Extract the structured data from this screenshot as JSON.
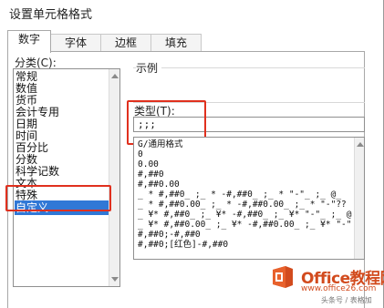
{
  "dialog": {
    "title": "设置单元格格式"
  },
  "tabs": [
    "数字",
    "字体",
    "边框",
    "填充"
  ],
  "category": {
    "label": "分类(C):",
    "items": [
      "常规",
      "数值",
      "货币",
      "会计专用",
      "日期",
      "时间",
      "百分比",
      "分数",
      "科学记数",
      "文本",
      "特殊",
      "自定义"
    ],
    "selected": "自定义"
  },
  "sample": {
    "label": "示例"
  },
  "type_field": {
    "label": "类型(T):",
    "value": ";;;"
  },
  "format_codes": [
    "G/通用格式",
    "0",
    "0.00",
    "#,##0",
    "#,##0.00",
    "_ * #,##0_ ;_ * -#,##0_ ;_ * \"-\"_ ;_ @_",
    "_ * #,##0.00_ ;_ * -#,##0.00_ ;_ * \"-\"??",
    "_ ¥* #,##0_ ;_ ¥* -#,##0_ ;_ ¥* \"-\"_ ;_ @",
    "_ ¥* #,##0.00_ ;_ ¥* -#,##0.00_ ;_ ¥* \"-\"",
    "#,##0;-#,##0",
    "#,##0;[红色]-#,##0"
  ],
  "watermark": {
    "brand": "Office教程网",
    "url": "www.office26.com",
    "credit": "头条号 / 表格加"
  },
  "colors": {
    "selection": "#3078d6",
    "highlight": "#e0301e",
    "brand": "#d24b1e"
  }
}
